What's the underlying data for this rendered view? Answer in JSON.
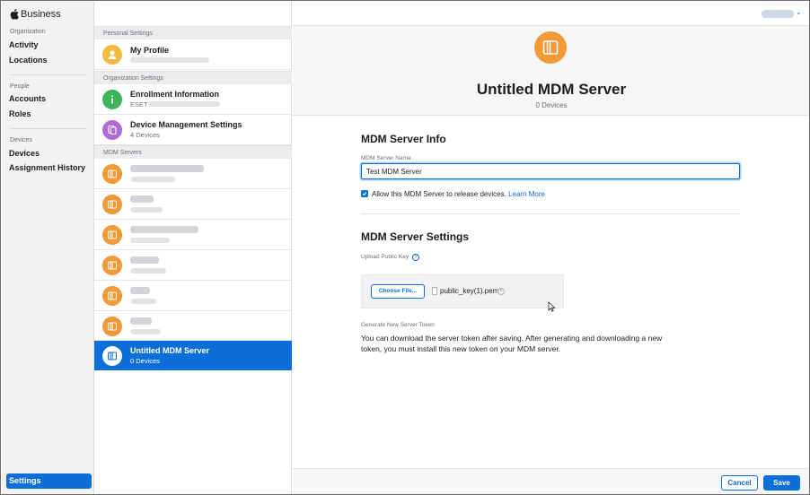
{
  "nav": {
    "brand": "Business",
    "groups": [
      {
        "label": "Organization",
        "items": [
          "Activity",
          "Locations"
        ]
      },
      {
        "label": "People",
        "items": [
          "Accounts",
          "Roles"
        ]
      },
      {
        "label": "Devices",
        "items": [
          "Devices",
          "Assignment History"
        ]
      }
    ],
    "settings_label": "Settings"
  },
  "list": {
    "personal_header": "Personal Settings",
    "my_profile": {
      "title": "My Profile"
    },
    "org_header": "Organization Settings",
    "enrollment": {
      "title": "Enrollment Information",
      "sub": "ESET"
    },
    "device_mgmt": {
      "title": "Device Management Settings",
      "sub": "4 Devices"
    },
    "mdm_header": "MDM Servers",
    "selected": {
      "title": "Untitled MDM Server",
      "sub": "0 Devices"
    }
  },
  "pane": {
    "hero_title": "Untitled MDM Server",
    "hero_sub": "0 Devices",
    "info_title": "MDM Server Info",
    "name_label": "MDM Server Name",
    "name_value": "Test MDM Server",
    "allow_text": "Allow this MDM Server to release devices.",
    "allow_checked": true,
    "learn_more": "Learn More",
    "settings_title": "MDM Server Settings",
    "upload_label": "Upload Public Key",
    "help_glyph": "?",
    "choose_file": "Choose File...",
    "file_name": "public_key(1).pem",
    "token_label": "Generate New Server Token",
    "token_text": "You can download the server token after saving. After generating and downloading a new token, you must install this new token on your MDM server.",
    "cancel": "Cancel",
    "save": "Save"
  },
  "colors": {
    "accent": "#0b6ed9",
    "mdm_icon": "#f29a38",
    "profile_icon": "#f5b942",
    "enrollment_icon": "#3db35a",
    "device_mgmt_icon": "#b06ad6"
  },
  "icons": {
    "brand": "apple-logo-icon",
    "profile": "person-icon",
    "enrollment": "info-icon",
    "device_mgmt": "device-stack-icon",
    "mdm": "server-icon"
  }
}
